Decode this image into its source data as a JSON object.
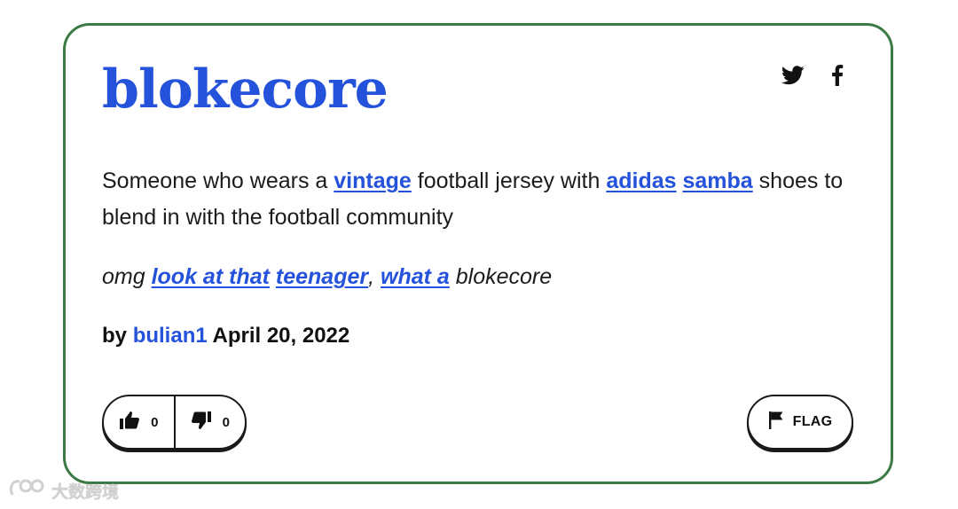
{
  "entry": {
    "word": "blokecore",
    "meaning": [
      {
        "text": "Someone who wears a ",
        "link": false
      },
      {
        "text": "vintage",
        "link": true
      },
      {
        "text": " football jersey with ",
        "link": false
      },
      {
        "text": "adidas",
        "link": true
      },
      {
        "text": " ",
        "link": false
      },
      {
        "text": "samba",
        "link": true
      },
      {
        "text": " shoes to blend in with the football community",
        "link": false
      }
    ],
    "example": [
      {
        "text": "omg ",
        "link": false
      },
      {
        "text": "look at that",
        "link": true
      },
      {
        "text": " ",
        "link": false
      },
      {
        "text": "teenager",
        "link": true
      },
      {
        "text": ", ",
        "link": false
      },
      {
        "text": "what a",
        "link": true
      },
      {
        "text": " blokecore",
        "link": false
      }
    ],
    "contributor": {
      "prefix": "by",
      "username": "bulian1",
      "date": "April 20, 2022"
    }
  },
  "share": {
    "icons": [
      "twitter-icon",
      "facebook-icon"
    ]
  },
  "votes": {
    "up_count": "0",
    "down_count": "0"
  },
  "flag": {
    "label": "FLAG"
  },
  "watermark": {
    "text": "大数跨境"
  },
  "colors": {
    "link_blue": "#2452db",
    "card_border": "#3c7a44",
    "text": "#1c1c1c"
  }
}
